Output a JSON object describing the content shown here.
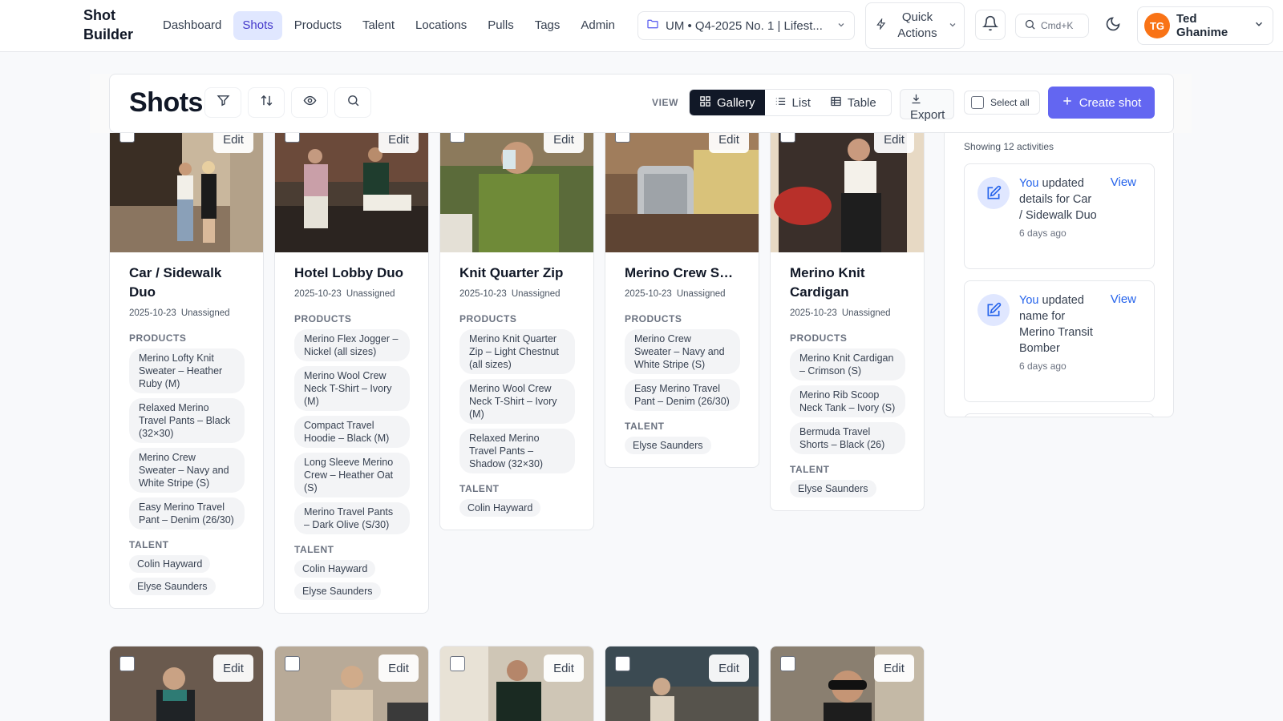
{
  "app": {
    "brand_line1": "Shot",
    "brand_line2": "Builder"
  },
  "nav": [
    {
      "label": "Dashboard",
      "active": false
    },
    {
      "label": "Shots",
      "active": true
    },
    {
      "label": "Products",
      "active": false
    },
    {
      "label": "Talent",
      "active": false
    },
    {
      "label": "Locations",
      "active": false
    },
    {
      "label": "Pulls",
      "active": false
    },
    {
      "label": "Tags",
      "active": false
    },
    {
      "label": "Admin",
      "active": false
    }
  ],
  "project": {
    "label": "UM • Q4-2025 No. 1 | Lifest..."
  },
  "quick_actions": {
    "label": "Quick Actions"
  },
  "search": {
    "shortcut": "Cmd+K"
  },
  "user": {
    "initials": "TG",
    "name": "Ted Ghanime"
  },
  "colors": {
    "accent": "#6366f1",
    "link": "#2563eb",
    "avatar": "#f97316"
  },
  "page": {
    "title": "Shots"
  },
  "toolbar": {
    "icons": [
      "filter-icon",
      "sort-icon",
      "eye-icon",
      "search-icon"
    ],
    "view_label": "VIEW",
    "views": [
      {
        "label": "Gallery",
        "icon": "grid-icon",
        "active": true
      },
      {
        "label": "List",
        "icon": "list-icon",
        "active": false
      },
      {
        "label": "Table",
        "icon": "table-icon",
        "active": false
      }
    ],
    "export_label": "Export",
    "select_all_label": "Select all",
    "create_label": "Create shot"
  },
  "labels": {
    "products": "PRODUCTS",
    "talent": "TALENT",
    "edit": "Edit"
  },
  "shots": [
    {
      "title": "Car / Sidewalk Duo",
      "date": "2025-10-23",
      "status": "Unassigned",
      "products": [
        "Merino Lofty Knit Sweater – Heather Ruby (M)",
        "Relaxed Merino Travel Pants – Black (32×30)",
        "Merino Crew Sweater – Navy and White Stripe (S)",
        "Easy Merino Travel Pant – Denim (26/30)"
      ],
      "talent": [
        "Colin Hayward",
        "Elyse Saunders"
      ]
    },
    {
      "title": "Hotel Lobby Duo",
      "date": "2025-10-23",
      "status": "Unassigned",
      "products": [
        "Merino Flex Jogger – Nickel (all sizes)",
        "Merino Wool Crew Neck T-Shirt – Ivory (M)",
        "Compact Travel Hoodie – Black (M)",
        "Long Sleeve Merino Crew – Heather Oat (S)",
        "Merino Travel Pants – Dark Olive (S/30)"
      ],
      "talent": [
        "Colin Hayward",
        "Elyse Saunders"
      ]
    },
    {
      "title": "Knit Quarter Zip",
      "date": "2025-10-23",
      "status": "Unassigned",
      "products": [
        "Merino Knit Quarter Zip – Light Chestnut (all sizes)",
        "Merino Wool Crew Neck T-Shirt – Ivory (M)",
        "Relaxed Merino Travel Pants – Shadow (32×30)"
      ],
      "talent": [
        "Colin Hayward"
      ]
    },
    {
      "title": "Merino Crew Sweater + Easy...",
      "date": "2025-10-23",
      "status": "Unassigned",
      "products": [
        "Merino Crew Sweater – Navy and White Stripe (S)",
        "Easy Merino Travel Pant – Denim (26/30)"
      ],
      "talent": [
        "Elyse Saunders"
      ]
    },
    {
      "title": "Merino Knit Cardigan",
      "date": "2025-10-23",
      "status": "Unassigned",
      "products": [
        "Merino Knit Cardigan – Crimson (S)",
        "Merino Rib Scoop Neck Tank – Ivory (S)",
        "Bermuda Travel Shorts – Black (26)"
      ],
      "talent": [
        "Elyse Saunders"
      ]
    }
  ],
  "activity": {
    "count_label": "Showing 12 activities",
    "view_label": "View",
    "items": [
      {
        "actor": "You",
        "text": "updated details for Car / Sidewalk Duo",
        "time": "6 days ago"
      },
      {
        "actor": "You",
        "text": "updated name for Merino Transit Bomber",
        "time": "6 days ago"
      }
    ]
  }
}
